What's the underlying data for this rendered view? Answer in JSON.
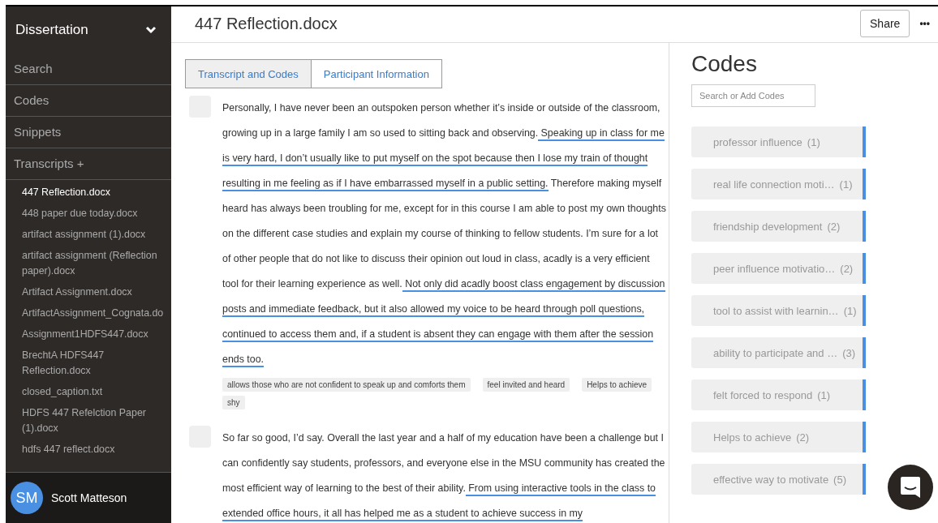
{
  "sidebar": {
    "project": "Dissertation",
    "nav": [
      {
        "label": "Search"
      },
      {
        "label": "Codes"
      },
      {
        "label": "Snippets"
      },
      {
        "label": "Transcripts +"
      }
    ],
    "files": [
      {
        "name": "447 Reflection.docx",
        "selected": true
      },
      {
        "name": "448 paper due today.docx",
        "selected": false
      },
      {
        "name": "artifact assignment (1).docx",
        "selected": false
      },
      {
        "name": "artifact assignment (Reflection paper).docx",
        "selected": false
      },
      {
        "name": "Artifact Assignment.docx",
        "selected": false
      },
      {
        "name": "ArtifactAssignment_Cognata.do",
        "selected": false
      },
      {
        "name": "Assignment1HDFS447.docx",
        "selected": false
      },
      {
        "name": "BrechtA HDFS447 Reflection.docx",
        "selected": false
      },
      {
        "name": "closed_caption.txt",
        "selected": false
      },
      {
        "name": "HDFS 447 Refelction Paper (1).docx",
        "selected": false
      },
      {
        "name": "hdfs 447 reflect.docx",
        "selected": false
      }
    ],
    "user": {
      "initials": "SM",
      "name": "Scott Matteson"
    }
  },
  "document": {
    "title": "447 Reflection.docx",
    "share": "Share",
    "more": "•••",
    "tabs": [
      {
        "label": "Transcript and Codes",
        "selected": true
      },
      {
        "label": "Participant Information",
        "selected": false
      }
    ],
    "paragraphs": [
      {
        "segments": [
          {
            "text": "Personally, I have never been an outspoken person whether it’s inside or outside of the classroom, growing up in a large family I am so used to sitting back and observing.",
            "coded": false
          },
          {
            "text": " Speaking up in class for me is very hard, I don’t usually like to put myself on the spot because then I lose my train of thought resulting in me feeling as if I have embarrassed myself in a public setting.",
            "coded": true
          },
          {
            "text": " Therefore making myself heard has always been troubling for me, except for in this course I am able to post my own thoughts on the different case studies and explain my course of thinking to fellow students. I’m sure for a lot of other people that do not like to discuss their opinion out loud in class, acadly is a very efficient tool for their learning experience as well.",
            "coded": false
          },
          {
            "text": " Not only did acadly boost class engagement by discussion posts and immediate feedback, but it also allowed my voice to be heard through poll questions, continued to access them and, if a student is absent they can engage with them after the session ends too.",
            "coded": true
          }
        ],
        "tags": [
          "allows those who are not confident to speak up and comforts them",
          "feel invited and heard",
          "Helps to achieve",
          "shy"
        ]
      },
      {
        "segments": [
          {
            "text": "So far so good, I’d say. Overall the last year and a half of my education have been a challenge but I can confidently say students, professors, and everyone else in the MSU community has created the most efficient way of learning to the best of their ability.",
            "coded": false
          },
          {
            "text": " From using interactive tools in the class to extended office hours, it all has helped me as a student to achieve success in my",
            "coded": true
          }
        ]
      }
    ]
  },
  "codes_panel": {
    "title": "Codes",
    "search": {
      "placeholder": "Search or Add Codes"
    },
    "codes": [
      {
        "label": "professor influence",
        "count": "(1)"
      },
      {
        "label": "real life connection moti…",
        "count": "(1)"
      },
      {
        "label": "friendship development",
        "count": "(2)"
      },
      {
        "label": "peer influence motivatio…",
        "count": "(2)"
      },
      {
        "label": "tool to assist with learnin…",
        "count": "(1)"
      },
      {
        "label": "ability to participate and …",
        "count": "(3)"
      },
      {
        "label": "felt forced to respond",
        "count": "(1)"
      },
      {
        "label": "Helps to achieve",
        "count": "(2)"
      },
      {
        "label": "effective way to motivate",
        "count": "(5)"
      }
    ]
  }
}
